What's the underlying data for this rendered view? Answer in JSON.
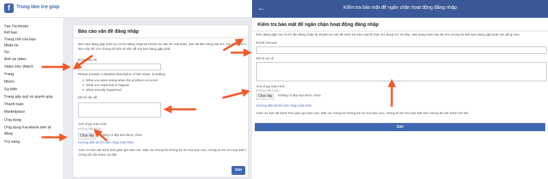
{
  "left": {
    "help_center_title": "Trung tâm trợ giúp",
    "logo_letter": "f",
    "nav_items": [
      "Tạo Tài khoản",
      "Kết bạn",
      "Trang chủ của bạn",
      "Nhắn tin",
      "Tin",
      "Ảnh và video",
      "Video trên Watch",
      "Trang",
      "Nhóm",
      "Sự kiện",
      "Trang gây quỹ và quyên góp",
      "Thanh toán",
      "Marketplace",
      "Ứng dụng",
      "Ứng dụng Facebook trên di",
      "động",
      "Trợ năng"
    ],
    "card_title": "Báo cáo vấn đề đăng nhập",
    "intro_line1": "Nếu bạn đang gặp phải sự cố khi đăng nhập tài khoản do vấn đề mật khẩu, bạn đã đến đúng địa chỉ. Vui lòng cho chúng tôi biết về vấn",
    "intro_line2": "đơn này để cho chúng tôi biết về vấn đề mà bạn đang gặp phải.",
    "email_label": "Email liên hệ",
    "describe_prompt": "Please provide a detailed description of this issue, including:",
    "describe_points": [
      "What you were doing when the problem occurred",
      "What you expected to happen",
      "What actually happened"
    ],
    "issue_label": "Mô tả vấn đề",
    "screenshot_label": "Ảnh chụp màn hình",
    "optional_label": "Không bắt buộc",
    "choose_file_button": "Chọn tệp",
    "no_file_text": "Không có tệp nào được chọn",
    "guide_link": "Hướng dẫn tải lên ảnh chụp màn hình",
    "thanks_line1": "Cảm ơn bạn đã dành thời gian gửi báo cáo. Mặc dù chúng tôi không trả lời mọi báo cáo, chúng tôi sẽ cho bạn biết nếu",
    "thanks_line2": "chúng tôi cần thêm chi tiết.",
    "send_button": "Gửi"
  },
  "right": {
    "top_title": "Kiểm tra bảo mật để ngăn chặn hoạt động đăng nhập",
    "card_title": "Kiểm tra bảo mật để ngăn chặn hoạt động đăng nhập",
    "intro": "Nếu đang gặp các rối thì lần đăng nhập tài khoản do vấn đề kiểm tra bảo mật thì bạn tìm đúng nơi rồi đấy. Hãy dùng mẫu này để cho chúng tôi biết bạn đang gặp phải vấn đề gì nhé.",
    "email_label": "Email của bạn",
    "issue_label": "Mô tả sự cố",
    "screenshot_label": "Ảnh chụp màn hình",
    "optional_label": "Không bắt buộc",
    "choose_file_button": "Chọn tệp",
    "no_file_text": "Không có tệp nào được chọn",
    "guide_link": "Hướng dẫn tải lên ảnh chụp màn hình",
    "thanks": "Cảm ơn bạn đã dành thời gian gửi báo cáo. Mặc dù chúng tôi không trả lời mọi báo cáo, chúng tôi sẽ cho bạn biết nếu chúng tôi cần thêm chi tiết.",
    "send_button": "Gửi"
  },
  "colors": {
    "facebook_blue": "#4267b2",
    "header_blue": "#3b5998",
    "annotation_arrow": "#f0592a"
  }
}
